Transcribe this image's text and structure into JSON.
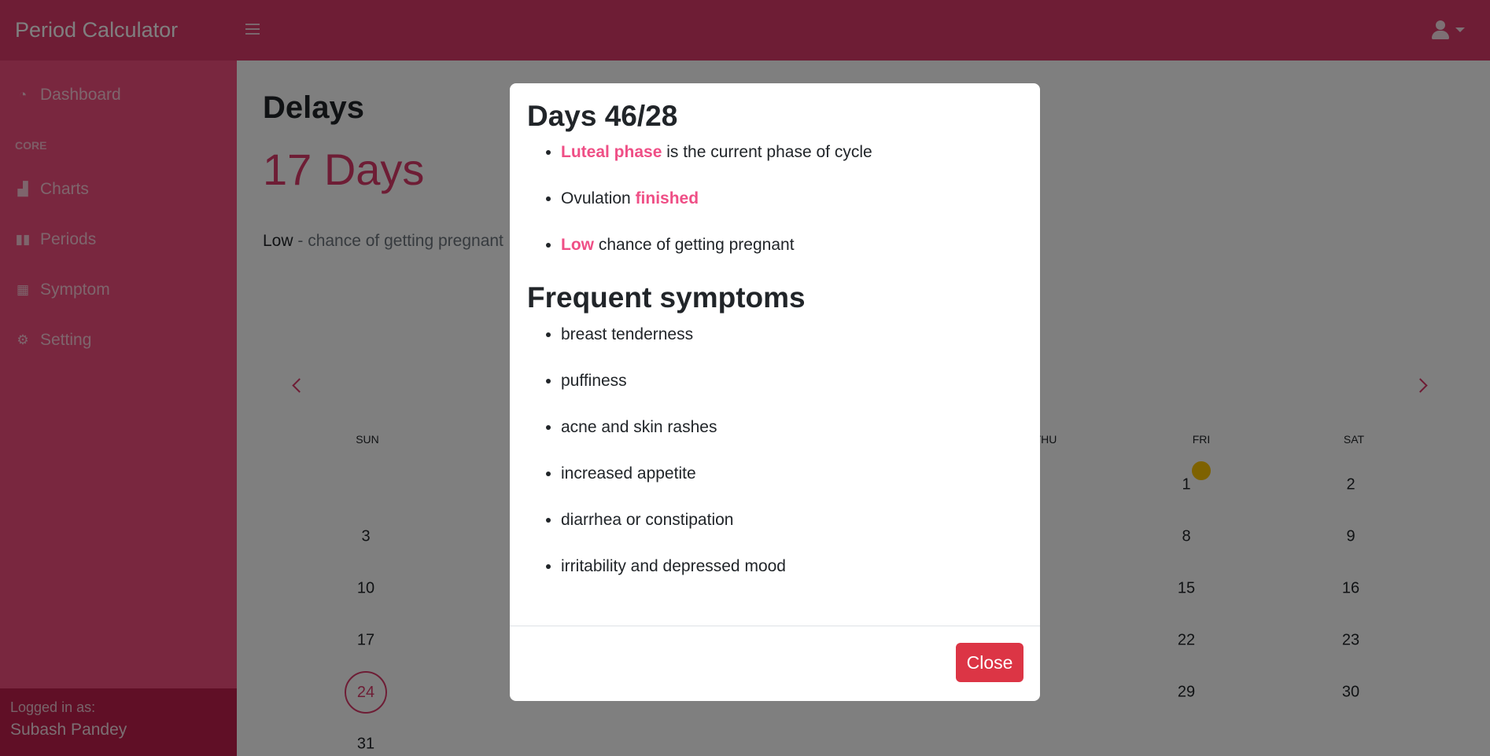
{
  "app": {
    "title": "Period Calculator"
  },
  "sidebar": {
    "items": [
      {
        "label": "Dashboard",
        "icon": "tachometer-icon"
      },
      {
        "label": "Charts",
        "icon": "chart-area-icon"
      },
      {
        "label": "Periods",
        "icon": "book-open-icon"
      },
      {
        "label": "Symptom",
        "icon": "table-icon"
      },
      {
        "label": "Setting",
        "icon": "cogs-icon"
      }
    ],
    "heading_core": "CORE",
    "footer": {
      "logged_in_label": "Logged in as:",
      "user_name": "Subash Pandey"
    }
  },
  "main": {
    "title": "Delays",
    "days_count": "17 Days",
    "chance_level": "Low",
    "chance_text": " - chance of getting pregnant"
  },
  "calendar": {
    "weekdays": {
      "sun": "SUN",
      "thu": "THU",
      "fri": "FRI",
      "sat": "SAT"
    },
    "days": {
      "d1": "1",
      "d2": "2",
      "d3": "3",
      "d8": "8",
      "d9": "9",
      "d10": "10",
      "d15": "15",
      "d16": "16",
      "d17": "17",
      "d22": "22",
      "d23": "23",
      "d24": "24",
      "d29": "29",
      "d30": "30",
      "d31": "31"
    },
    "today": "24",
    "marker_color": "#fcc400"
  },
  "modal": {
    "title": "Days 46/28",
    "phase": {
      "highlight": "Luteal phase",
      "text": " is the current phase of cycle"
    },
    "ovulation": {
      "text": "Ovulation ",
      "highlight": "finished"
    },
    "chance": {
      "highlight": "Low",
      "text": " chance of getting pregnant"
    },
    "symptoms_title": "Frequent symptoms",
    "symptoms": [
      "breast tenderness",
      "puffiness",
      "acne and skin rashes",
      "increased appetite",
      "diarrhea or constipation",
      "irritability and depressed mood"
    ],
    "close_label": "Close"
  },
  "colors": {
    "brand": "#dc3a6b",
    "sidebar": "#f34f7f",
    "highlight": "#ef4f86",
    "danger": "#dc3545"
  }
}
